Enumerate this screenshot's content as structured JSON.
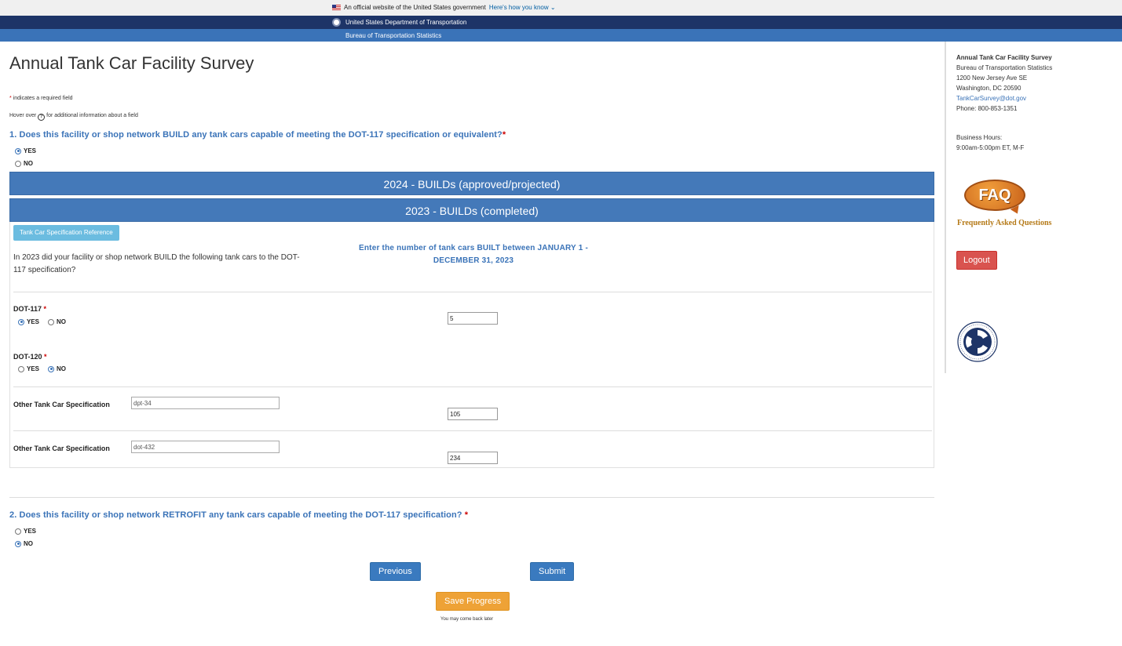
{
  "gov_banner": {
    "text": "An official website of the United States government",
    "link": "Here's how you know"
  },
  "dot_bar": {
    "text": "United States Department of Transportation"
  },
  "bts_bar": {
    "text": "Bureau of Transportation Statistics"
  },
  "page": {
    "title": "Annual Tank Car Facility Survey",
    "required_mark": "*",
    "required_note": " indicates a required field",
    "hover_prefix": "Hover over",
    "hover_icon": "?",
    "hover_suffix": "for additional information about a field"
  },
  "question1": {
    "text": "1. Does this facility or shop network BUILD any tank cars capable of meeting the DOT-117 specification or equivalent?",
    "required": "*",
    "options": [
      {
        "label": "YES",
        "checked": true
      },
      {
        "label": "NO",
        "checked": false
      }
    ]
  },
  "sections": {
    "builds_2024": "2024 - BUILDs (approved/projected)",
    "builds_2023": "2023 - BUILDs (completed)"
  },
  "panel": {
    "ref_button": "Tank Car Specification Reference",
    "question": "In 2023 did your facility or shop network BUILD the following tank cars to the DOT-117 specification?",
    "instruction": "Enter the number of tank cars BUILT between JANUARY 1 - DECEMBER 31, 2023",
    "dot117": {
      "label": "DOT-117",
      "required": "*",
      "yes": "YES",
      "no": "NO",
      "selected": "YES",
      "count": "5"
    },
    "dot120": {
      "label": "DOT-120",
      "required": "*",
      "yes": "YES",
      "no": "NO",
      "selected": "NO"
    },
    "others": [
      {
        "label": "Other Tank Car Specification",
        "spec": "dpt-34",
        "count": "105"
      },
      {
        "label": "Other Tank Car Specification",
        "spec": "dot-432",
        "count": "234"
      }
    ]
  },
  "question2": {
    "text": "2. Does this facility or shop network RETROFIT any tank cars capable of meeting the DOT-117 specification?",
    "required": "*",
    "options": [
      {
        "label": "YES",
        "checked": false
      },
      {
        "label": "NO",
        "checked": true
      }
    ]
  },
  "buttons": {
    "previous": "Previous",
    "submit": "Submit",
    "save": "Save Progress",
    "save_note": "You may come back later"
  },
  "sidebar": {
    "contact_name": "Annual Tank Car Facility Survey",
    "org": "Bureau of Transportation Statistics",
    "address1": "1200 New Jersey Ave SE",
    "address2": "Washington, DC 20590",
    "email": "TankCarSurvey@dot.gov",
    "phone": "Phone: 800-853-1351",
    "hours_label": "Business Hours:",
    "hours": "9:00am-5:00pm ET, M-F",
    "faq_logo": "FAQ",
    "faq_text": "Frequently Asked Questions",
    "logout": "Logout"
  },
  "colors": {
    "navy": "#1d3467",
    "blue": "#3a73b8",
    "section": "#4479b9",
    "save": "#eea236",
    "logout": "#d9534f"
  }
}
